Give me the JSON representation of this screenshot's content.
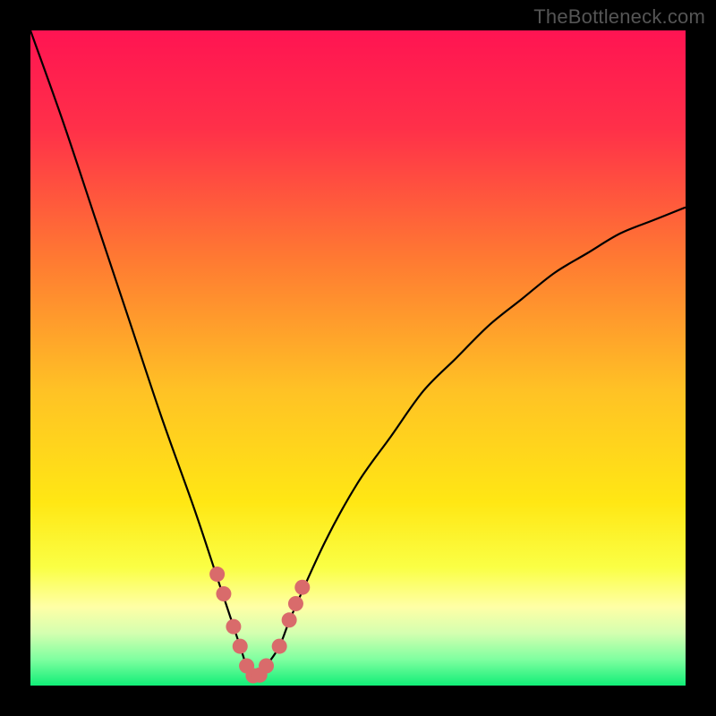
{
  "watermark": "TheBottleneck.com",
  "colors": {
    "frame": "#000000",
    "curve": "#000000",
    "beads": "#d96b6b",
    "gradient_stops": [
      {
        "offset": 0.0,
        "color": "#ff1452"
      },
      {
        "offset": 0.15,
        "color": "#ff3049"
      },
      {
        "offset": 0.35,
        "color": "#ff7a32"
      },
      {
        "offset": 0.55,
        "color": "#ffc225"
      },
      {
        "offset": 0.72,
        "color": "#ffe714"
      },
      {
        "offset": 0.82,
        "color": "#faff45"
      },
      {
        "offset": 0.88,
        "color": "#ffffa6"
      },
      {
        "offset": 0.92,
        "color": "#d4ffb0"
      },
      {
        "offset": 0.96,
        "color": "#7fffa0"
      },
      {
        "offset": 1.0,
        "color": "#11ee77"
      }
    ]
  },
  "chart_data": {
    "type": "line",
    "title": "",
    "xlabel": "",
    "ylabel": "",
    "xlim": [
      0,
      100
    ],
    "ylim": [
      0,
      100
    ],
    "grid": false,
    "legend": false,
    "notes": "V-shaped bottleneck curve on traffic-light gradient. Minimum (green) near x≈34. Values are percentage height of the curve above the bottom edge, read off the plot.",
    "x": [
      0,
      5,
      10,
      15,
      20,
      25,
      28,
      30,
      32,
      33,
      34,
      35,
      36,
      38,
      40,
      45,
      50,
      55,
      60,
      65,
      70,
      75,
      80,
      85,
      90,
      95,
      100
    ],
    "values": [
      100,
      86,
      71,
      56,
      41,
      27,
      18,
      12,
      6,
      3,
      1.5,
      1.5,
      3,
      6,
      11,
      22,
      31,
      38,
      45,
      50,
      55,
      59,
      63,
      66,
      69,
      71,
      73
    ],
    "beads_x": [
      28.5,
      29.5,
      31.0,
      32.0,
      33.0,
      34.0,
      35.0,
      36.0,
      38.0,
      39.5,
      40.5,
      41.5
    ],
    "beads_y": [
      17.0,
      14.0,
      9.0,
      6.0,
      3.0,
      1.5,
      1.6,
      3.0,
      6.0,
      10.0,
      12.5,
      15.0
    ]
  }
}
